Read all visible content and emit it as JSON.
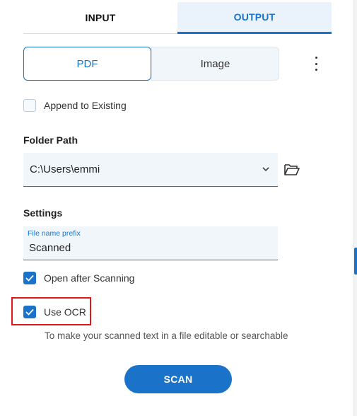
{
  "tabs": {
    "input": "INPUT",
    "output": "OUTPUT"
  },
  "format": {
    "pdf": "PDF",
    "image": "Image",
    "selected": "PDF"
  },
  "append": {
    "label": "Append to Existing",
    "checked": false
  },
  "folder": {
    "label": "Folder Path",
    "value": "C:\\Users\\emmi"
  },
  "settings": {
    "label": "Settings",
    "prefix_label": "File name prefix",
    "prefix_value": "Scanned",
    "open_after": {
      "label": "Open after Scanning",
      "checked": true
    },
    "use_ocr": {
      "label": "Use OCR",
      "checked": true
    },
    "ocr_hint": "To make your scanned text in a file editable or searchable"
  },
  "scan_button": "SCAN",
  "colors": {
    "accent": "#1a73c9",
    "highlight": "#e0161b"
  },
  "icons": [
    "more-vertical-icon",
    "chevron-down-icon",
    "folder-open-icon",
    "checkmark-icon"
  ]
}
